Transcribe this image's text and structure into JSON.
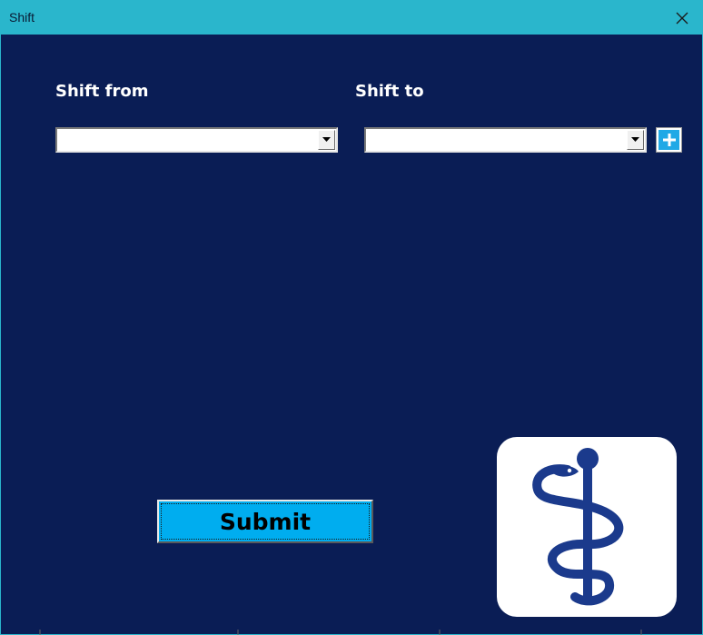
{
  "window": {
    "title": "Shift",
    "close_icon": "close-icon"
  },
  "form": {
    "shift_from_label": "Shift from",
    "shift_to_label": "Shift to",
    "shift_from_value": "",
    "shift_to_value": "",
    "add_icon": "plus-icon",
    "submit_label": "Submit"
  },
  "logo": {
    "icon": "rod-of-asclepius-icon"
  },
  "colors": {
    "titlebar": "#2ab6cc",
    "background": "#0a1d55",
    "submit": "#00adef",
    "add_button": "#21a9e6",
    "logo_symbol": "#1b3a8c"
  }
}
